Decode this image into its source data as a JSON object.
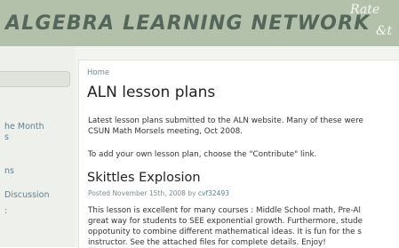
{
  "header": {
    "site_title": "ALGEBRA LEARNING NETWORK",
    "rate_line1": "Rate",
    "rate_line2": "&t"
  },
  "sidebar": {
    "items": [
      {
        "label": "he Month"
      },
      {
        "label": "s"
      },
      {
        "label": "ns"
      },
      {
        "label": " Discussion"
      },
      {
        "label": ":"
      }
    ]
  },
  "main": {
    "breadcrumb": "Home",
    "page_title": "ALN lesson plans",
    "intro_lines": [
      "Latest lesson plans submitted to the ALN website. Many of these were",
      "CSUN Math Morsels meeting, Oct 2008."
    ],
    "contribute_line": "To add your own lesson plan, choose the \"Contribute\" link.",
    "post": {
      "title": "Skittles Explosion",
      "meta_prefix": "Posted November 15th, 2008 by ",
      "author": "cvf32493",
      "body_lines": [
        "This lesson is excellent for many courses : Middle School math, Pre-Al",
        "great way for students to SEE exponential growth. Furthermore, stude",
        "oppotunity to combine different mathematical ideas. It is fun for the s",
        "instructor. See the attached files for complete details. Enjoy!"
      ]
    }
  },
  "colors": {
    "header_bg": "#b3c1aa",
    "title_color": "#55665a",
    "link_color": "#617f8a"
  }
}
